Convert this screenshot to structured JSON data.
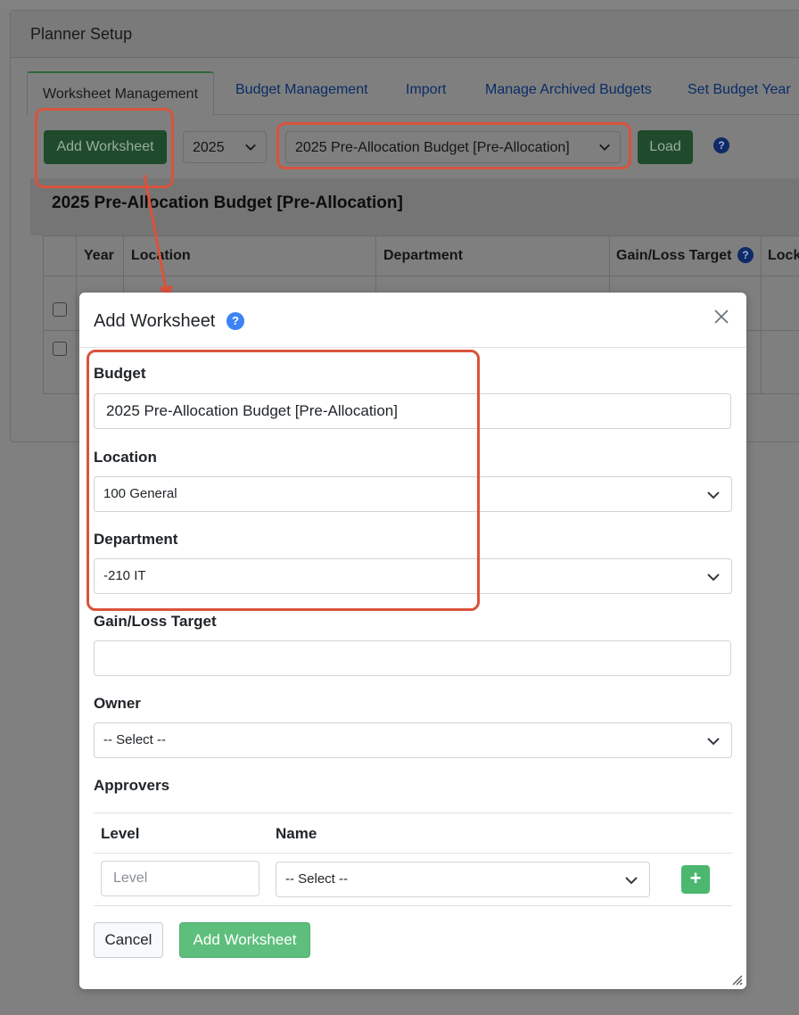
{
  "card": {
    "title": "Planner Setup",
    "tabs": [
      "Worksheet Management",
      "Budget Management",
      "Import",
      "Manage Archived Budgets",
      "Set Budget Year"
    ],
    "toolbar": {
      "add_worksheet_label": "Add Worksheet",
      "year_value": "2025",
      "budget_value": "2025 Pre-Allocation Budget [Pre-Allocation]",
      "load_label": "Load",
      "help_symbol": "?"
    },
    "section_title": "2025 Pre-Allocation Budget [Pre-Allocation]",
    "table_headers": [
      "Year",
      "Location",
      "Department",
      "Gain/Loss Target",
      "Lock"
    ]
  },
  "modal": {
    "title": "Add Worksheet",
    "help_symbol": "?",
    "close_symbol": "×",
    "fields": {
      "budget_label": "Budget",
      "budget_value": "2025 Pre-Allocation Budget [Pre-Allocation]",
      "location_label": "Location",
      "location_value": "100 General",
      "department_label": "Department",
      "department_value": "-210 IT",
      "gain_loss_label": "Gain/Loss Target",
      "gain_loss_value": "",
      "owner_label": "Owner",
      "owner_value": "-- Select --"
    },
    "approvers": {
      "label": "Approvers",
      "col_level": "Level",
      "col_name": "Name",
      "level_placeholder": "Level",
      "name_value": "-- Select --",
      "add_symbol": "+"
    },
    "footer": {
      "cancel_label": "Cancel",
      "submit_label": "Add Worksheet"
    }
  },
  "colors": {
    "annotation_red": "#d9533c",
    "primary_green": "#5ebf7c",
    "help_blue": "#3d83f5"
  }
}
